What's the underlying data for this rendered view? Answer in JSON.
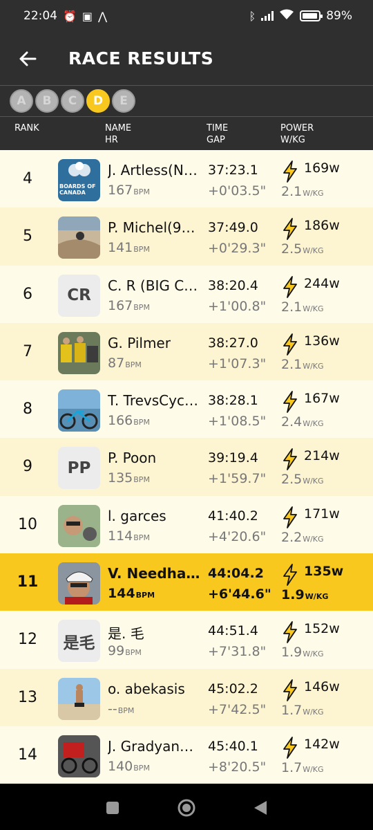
{
  "status": {
    "time": "22:04",
    "battery": "89%"
  },
  "app": {
    "title": "RACE RESULTS"
  },
  "categories": [
    "A",
    "B",
    "C",
    "D",
    "E"
  ],
  "active_category": "D",
  "headers": {
    "rank": "RANK",
    "name": "NAME",
    "hr": "HR",
    "time": "TIME",
    "gap": "GAP",
    "power": "POWER",
    "wkg": "W/KG"
  },
  "units": {
    "bpm": "BPM",
    "wkg": "W/KG"
  },
  "results": [
    {
      "rank": "4",
      "name": "J. Artless(N…",
      "hr": "167",
      "time": "37:23.1",
      "gap": "+0'03.5\"",
      "watts": "169w",
      "wkg": "2.1",
      "avatar": "boards-of-canada-photo",
      "avatar_text": "BOARDS OF CANADA"
    },
    {
      "rank": "5",
      "name": "P. Michel(9…",
      "hr": "141",
      "time": "37:49.0",
      "gap": "+0'29.3\"",
      "watts": "186w",
      "wkg": "2.5",
      "avatar": "dirt-track-photo"
    },
    {
      "rank": "6",
      "name": "C. R (BIG C…",
      "hr": "167",
      "time": "38:20.4",
      "gap": "+1'00.8\"",
      "watts": "244w",
      "wkg": "2.1",
      "avatar": "initials",
      "initials": "CR"
    },
    {
      "rank": "7",
      "name": "G. Pilmer",
      "hr": "87",
      "time": "38:27.0",
      "gap": "+1'07.3\"",
      "watts": "136w",
      "wkg": "2.1",
      "avatar": "cyclists-group-photo"
    },
    {
      "rank": "8",
      "name": "T. TrevsCyc…",
      "hr": "166",
      "time": "38:28.1",
      "gap": "+1'08.5\"",
      "watts": "167w",
      "wkg": "2.4",
      "avatar": "bike-lake-photo"
    },
    {
      "rank": "9",
      "name": "P. Poon",
      "hr": "135",
      "time": "39:19.4",
      "gap": "+1'59.7\"",
      "watts": "214w",
      "wkg": "2.5",
      "avatar": "initials",
      "initials": "PP"
    },
    {
      "rank": "10",
      "name": "l. garces",
      "hr": "114",
      "time": "41:40.2",
      "gap": "+4'20.6\"",
      "watts": "171w",
      "wkg": "2.2",
      "avatar": "selfie-photo"
    },
    {
      "rank": "11",
      "name": "V. Needha…",
      "hr": "144",
      "time": "44:04.2",
      "gap": "+6'44.6\"",
      "watts": "135w",
      "wkg": "1.9",
      "avatar": "helmet-selfie-photo",
      "highlight": true
    },
    {
      "rank": "12",
      "name": "是. 毛",
      "hr": "99",
      "time": "44:51.4",
      "gap": "+7'31.8\"",
      "watts": "152w",
      "wkg": "1.9",
      "avatar": "initials",
      "initials": "是毛"
    },
    {
      "rank": "13",
      "name": "o. abekasis",
      "hr": "--",
      "time": "45:02.2",
      "gap": "+7'42.5\"",
      "watts": "146w",
      "wkg": "1.7",
      "avatar": "beach-photo"
    },
    {
      "rank": "14",
      "name": "J. Gradyan…",
      "hr": "140",
      "time": "45:40.1",
      "gap": "+8'20.5\"",
      "watts": "142w",
      "wkg": "1.7",
      "avatar": "cycling-red-photo"
    }
  ],
  "colors": {
    "accent": "#f8c81e",
    "bar": "#2f2f2f",
    "row_odd": "#fefbe9",
    "row_even": "#fdf4d2"
  }
}
